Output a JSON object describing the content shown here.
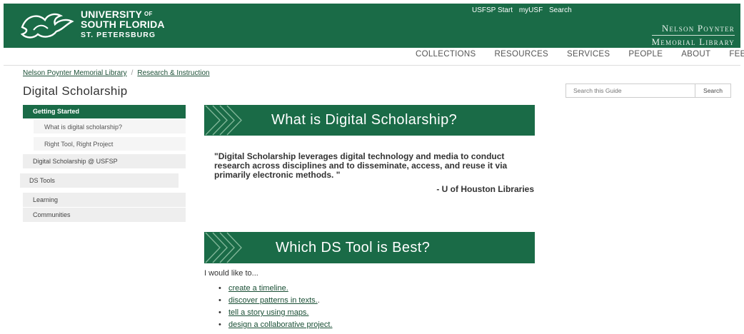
{
  "header": {
    "university_line1": "UNIVERSITY",
    "university_of": "OF",
    "university_line2": "SOUTH FLORIDA",
    "campus": "ST. PETERSBURG",
    "utility_links": [
      "USFSP Start",
      "myUSF",
      "Search"
    ],
    "library_line1": "Nelson Poynter",
    "library_line2": "Memorial Library",
    "brand_color": "#1a6b47"
  },
  "topnav": [
    "COLLECTIONS",
    "RESOURCES",
    "SERVICES",
    "PEOPLE",
    "ABOUT",
    "FEEDBACK"
  ],
  "breadcrumb": {
    "items": [
      "Nelson Poynter Memorial Library",
      "Research & Instruction"
    ],
    "separator": "/"
  },
  "page_title": "Digital Scholarship",
  "search": {
    "placeholder": "Search this Guide",
    "button_label": "Search"
  },
  "sidebar": {
    "active": "Getting Started",
    "subitems": [
      "What is digital scholarship?",
      "Right Tool, Right Project"
    ],
    "items": [
      "Digital Scholarship @ USFSP",
      "DS Tools",
      "Learning",
      "Communities"
    ]
  },
  "main": {
    "banner1_title": "What is Digital Scholarship?",
    "quote": "\"Digital Scholarship leverages digital technology and media to conduct research across disciplines and to disseminate, access, and reuse it via primarily electronic methods. \"",
    "quote_attribution": "- U of Houston Libraries",
    "banner2_title": "Which DS Tool is Best?",
    "prompt": "I would like to...",
    "tool_links": [
      "create a timeline.",
      "discover patterns in texts.",
      "tell a story using maps.",
      "design a collaborative project."
    ],
    "tool_suffixes": [
      "",
      ".",
      "",
      ""
    ]
  }
}
